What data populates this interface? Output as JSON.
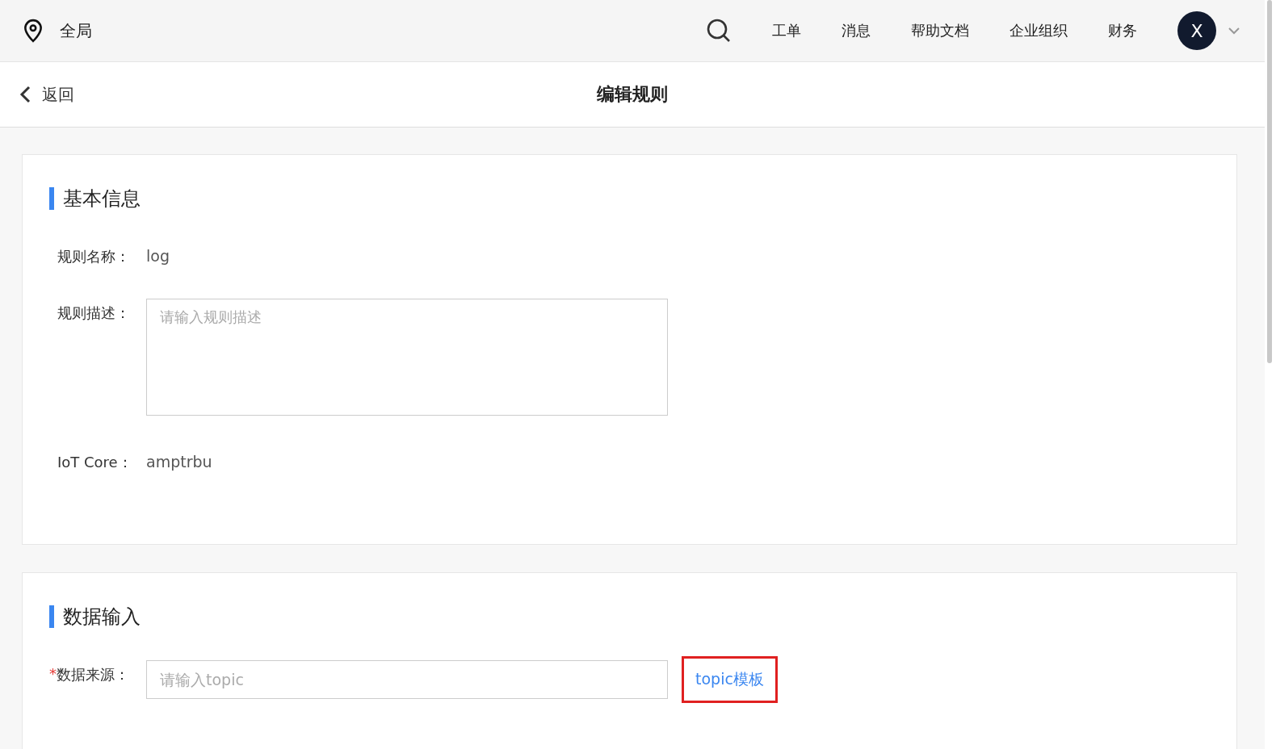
{
  "topbar": {
    "region": "全局",
    "nav": [
      "工单",
      "消息",
      "帮助文档",
      "企业组织",
      "财务"
    ],
    "avatar": "X"
  },
  "header": {
    "back": "返回",
    "title": "编辑规则"
  },
  "sections": [
    {
      "title": "基本信息",
      "fields": [
        {
          "kind": "text",
          "label": "规则名称：",
          "value": "log"
        },
        {
          "kind": "textarea",
          "label": "规则描述：",
          "placeholder": "请输入规则描述"
        },
        {
          "kind": "text",
          "label": "IoT Core：",
          "value": "amptrbu"
        }
      ]
    },
    {
      "title": "数据输入",
      "fields": [
        {
          "kind": "input",
          "label": "数据来源：",
          "placeholder": "请输入topic",
          "required_mark": "*",
          "link": "topic模板"
        }
      ]
    }
  ]
}
